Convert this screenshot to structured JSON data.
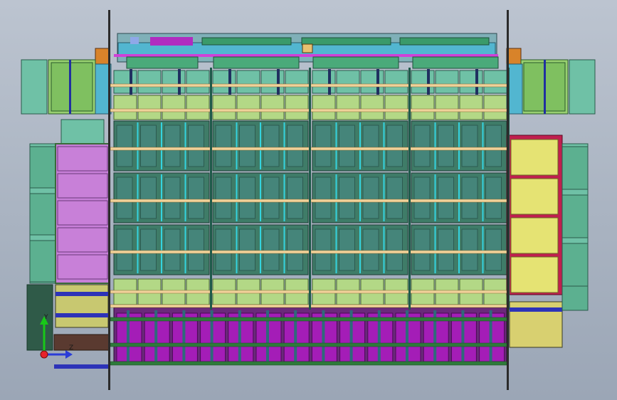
{
  "viewport": {
    "name": "cad-top-view",
    "background": "#b3bccb"
  },
  "triad": {
    "y_label": "Y",
    "z_label": "Z",
    "x_color": "#e8222a",
    "y_color": "#18c818",
    "z_color": "#2a3cd8"
  },
  "colors": {
    "frame_post": "#2b2b2b",
    "cell_teal": "#6fc1a6",
    "cell_light_green": "#b3d886",
    "battery_dark_green": "#3f7c68",
    "cyan_divider": "#34d3df",
    "rail_tan": "#f0d29a",
    "rail_green": "#2e7a3a",
    "purple_module": "#a41db7",
    "magenta_rail": "#d040d8",
    "violet_panel": "#c77fd8",
    "yellow_panel": "#e5e373",
    "crimson_frame": "#c01f4f",
    "header_blue": "#52b6d0",
    "blue_bar": "#2d33b8",
    "orange_bracket": "#d8832a"
  }
}
